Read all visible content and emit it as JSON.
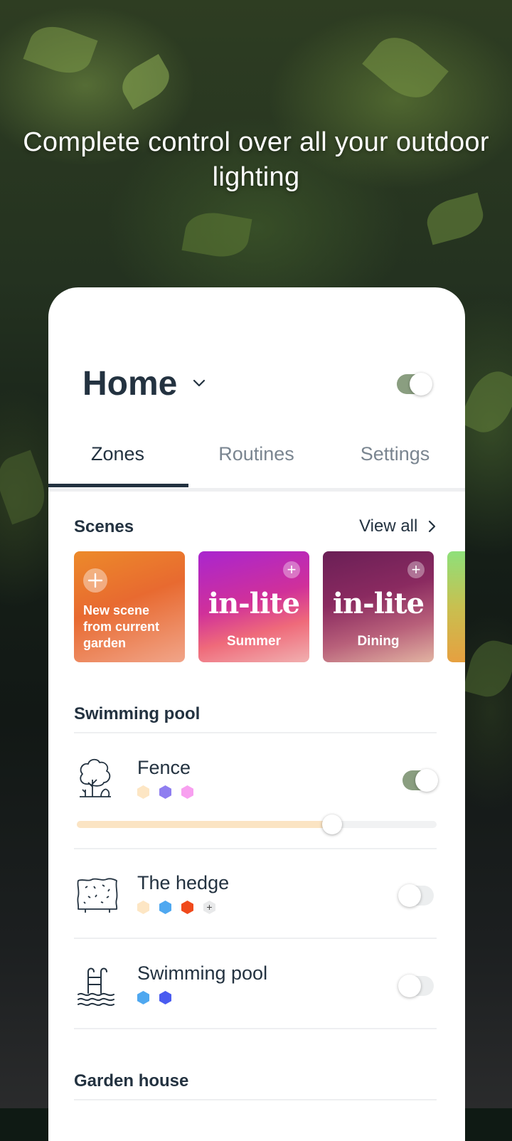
{
  "headline": "Complete control over all your outdoor lighting",
  "header": {
    "title": "Home",
    "dropdown_icon": "chevron-down-icon",
    "master_toggle_on": true
  },
  "tabs": [
    {
      "label": "Zones",
      "active": true
    },
    {
      "label": "Routines",
      "active": false
    },
    {
      "label": "Settings",
      "active": false
    }
  ],
  "scenes": {
    "title": "Scenes",
    "view_all": "View all",
    "items": [
      {
        "label": "New scene from current garden",
        "brand": "",
        "colors": [
          "#e0402a",
          "#f5a86a"
        ]
      },
      {
        "label": "Summer",
        "brand": "in-lite",
        "colors": [
          "#b02fd0",
          "#f0a0b0"
        ]
      },
      {
        "label": "Dining",
        "brand": "in-lite",
        "colors": [
          "#7a1f5a",
          "#d8a090"
        ]
      }
    ]
  },
  "groups": [
    {
      "title": "Swimming pool",
      "zones": [
        {
          "name": "Fence",
          "icon": "tree-icon",
          "on": true,
          "brightness": 0.71,
          "colors": [
            "#fde6c4",
            "#8f7ef0",
            "#f8a0f0"
          ],
          "more": ""
        },
        {
          "name": "The hedge",
          "icon": "hedge-icon",
          "on": false,
          "colors": [
            "#fde6c4",
            "#4fa8f0",
            "#f04a1c"
          ],
          "more": "+"
        },
        {
          "name": "Swimming pool",
          "icon": "pool-ladder-icon",
          "on": false,
          "colors": [
            "#4fa8f0",
            "#4a5cf0"
          ],
          "more": ""
        }
      ]
    },
    {
      "title": "Garden house",
      "zones": []
    }
  ]
}
